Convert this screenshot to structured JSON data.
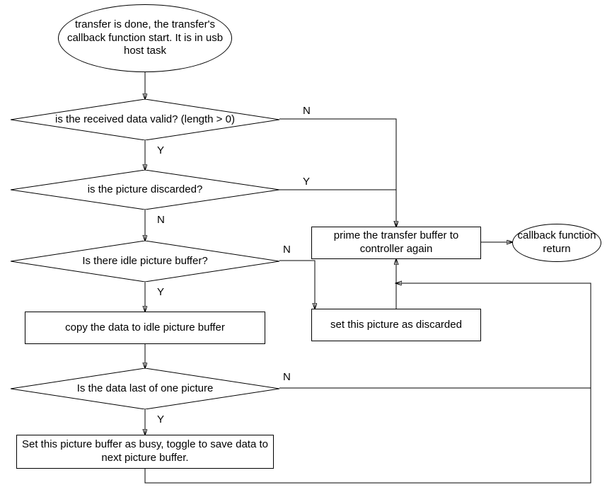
{
  "nodes": {
    "start": "transfer is done, the transfer's callback function start. It is in usb host task",
    "d1": "is the received data valid? (length > 0)",
    "d2": "is the picture discarded?",
    "d3": "Is there idle picture buffer?",
    "p_copy": "copy the data to idle picture buffer",
    "d4": "Is the data last of one picture",
    "p_setbusy": "Set this picture buffer as busy, toggle to save data to next picture buffer.",
    "p_discard": "set this picture as discarded",
    "p_prime": "prime the transfer buffer to controller again",
    "end": "callback function return"
  },
  "labels": {
    "yes": "Y",
    "no": "N"
  }
}
